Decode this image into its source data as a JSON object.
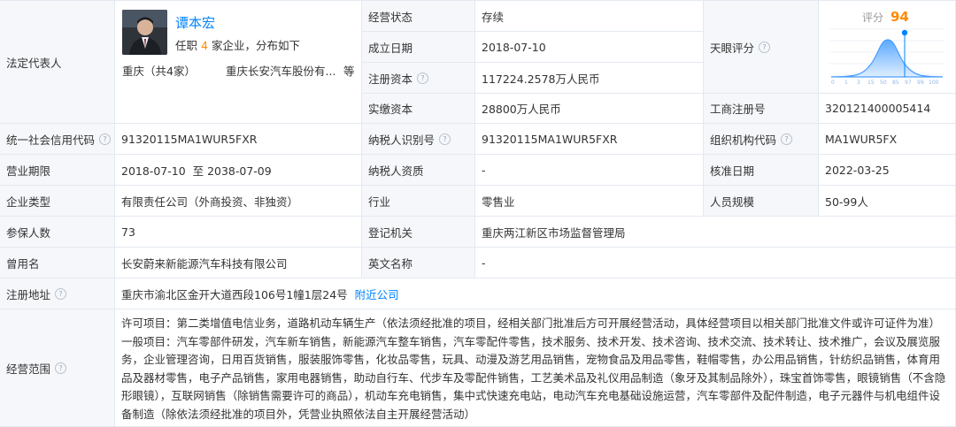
{
  "legal_rep": {
    "label": "法定代表人",
    "name": "谭本宏",
    "positions_pre": "任职",
    "positions_count": "4",
    "positions_post": "家企业，分布如下",
    "region": "重庆（共4家）",
    "company": "重庆长安汽车股份有...",
    "more": "等"
  },
  "status": {
    "label": "经营状态",
    "value": "存续"
  },
  "established": {
    "label": "成立日期",
    "value": "2018-07-10"
  },
  "reg_capital": {
    "label": "注册资本",
    "value": "117224.2578万人民币"
  },
  "paid_capital": {
    "label": "实缴资本",
    "value": "28800万人民币"
  },
  "tianyan": {
    "label": "天眼评分",
    "score_label": "评分",
    "score": "94",
    "axis": [
      "0",
      "1",
      "3",
      "15",
      "50",
      "85",
      "97",
      "99",
      "100"
    ]
  },
  "biz_reg_no": {
    "label": "工商注册号",
    "value": "320121400005414"
  },
  "credit_code": {
    "label": "统一社会信用代码",
    "value": "91320115MA1WUR5FXR"
  },
  "taxpayer_id": {
    "label": "纳税人识别号",
    "value": "91320115MA1WUR5FXR"
  },
  "org_code": {
    "label": "组织机构代码",
    "value": "MA1WUR5FX"
  },
  "term": {
    "label": "营业期限",
    "value": "2018-07-10  至 2038-07-09"
  },
  "taxpayer_qual": {
    "label": "纳税人资质",
    "value": "-"
  },
  "approval_date": {
    "label": "核准日期",
    "value": "2022-03-25"
  },
  "company_type": {
    "label": "企业类型",
    "value": "有限责任公司（外商投资、非独资）"
  },
  "industry": {
    "label": "行业",
    "value": "零售业"
  },
  "staff_size": {
    "label": "人员规模",
    "value": "50-99人"
  },
  "insured": {
    "label": "参保人数",
    "value": "73"
  },
  "reg_authority": {
    "label": "登记机关",
    "value": "重庆两江新区市场监督管理局"
  },
  "former_name": {
    "label": "曾用名",
    "value": "长安蔚来新能源汽车科技有限公司"
  },
  "english_name": {
    "label": "英文名称",
    "value": "-"
  },
  "address": {
    "label": "注册地址",
    "value": "重庆市渝北区金开大道西段106号1幢1层24号",
    "link": "附近公司"
  },
  "scope": {
    "label": "经营范围",
    "value": "许可项目：第二类增值电信业务，道路机动车辆生产（依法须经批准的项目，经相关部门批准后方可开展经营活动，具体经营项目以相关部门批准文件或许可证件为准）一般项目：汽车零部件研发，汽车新车销售，新能源汽车整车销售，汽车零配件零售，技术服务、技术开发、技术咨询、技术交流、技术转让、技术推广，会议及展览服务，企业管理咨询，日用百货销售，服装服饰零售，化妆品零售，玩具、动漫及游艺用品销售，宠物食品及用品零售，鞋帽零售，办公用品销售，针纺织品销售，体育用品及器材零售，电子产品销售，家用电器销售，助动自行车、代步车及零配件销售，工艺美术品及礼仪用品制造（象牙及其制品除外），珠宝首饰零售，眼镜销售（不含隐形眼镜），互联网销售（除销售需要许可的商品），机动车充电销售，集中式快速充电站，电动汽车充电基础设施运营，汽车零部件及配件制造，电子元器件与机电组件设备制造（除依法须经批准的项目外，凭营业执照依法自主开展经营活动）"
  },
  "colors": {
    "accent": "#0084ff",
    "score": "#ff8a00",
    "label_bg": "#f5f7fa",
    "border": "#e4e9f1"
  }
}
